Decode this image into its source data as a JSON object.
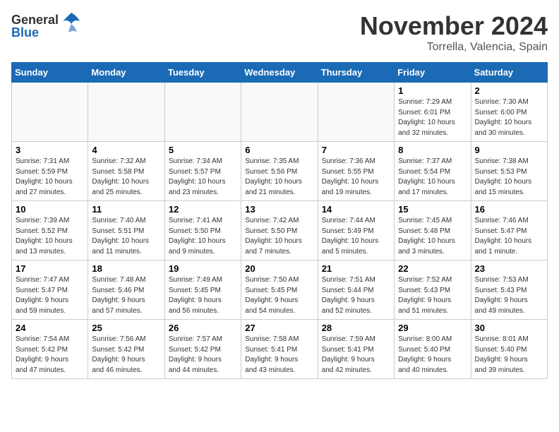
{
  "header": {
    "logo_general": "General",
    "logo_blue": "Blue",
    "month": "November 2024",
    "location": "Torrella, Valencia, Spain"
  },
  "weekdays": [
    "Sunday",
    "Monday",
    "Tuesday",
    "Wednesday",
    "Thursday",
    "Friday",
    "Saturday"
  ],
  "weeks": [
    [
      {
        "day": "",
        "info": ""
      },
      {
        "day": "",
        "info": ""
      },
      {
        "day": "",
        "info": ""
      },
      {
        "day": "",
        "info": ""
      },
      {
        "day": "",
        "info": ""
      },
      {
        "day": "1",
        "info": "Sunrise: 7:29 AM\nSunset: 6:01 PM\nDaylight: 10 hours\nand 32 minutes."
      },
      {
        "day": "2",
        "info": "Sunrise: 7:30 AM\nSunset: 6:00 PM\nDaylight: 10 hours\nand 30 minutes."
      }
    ],
    [
      {
        "day": "3",
        "info": "Sunrise: 7:31 AM\nSunset: 5:59 PM\nDaylight: 10 hours\nand 27 minutes."
      },
      {
        "day": "4",
        "info": "Sunrise: 7:32 AM\nSunset: 5:58 PM\nDaylight: 10 hours\nand 25 minutes."
      },
      {
        "day": "5",
        "info": "Sunrise: 7:34 AM\nSunset: 5:57 PM\nDaylight: 10 hours\nand 23 minutes."
      },
      {
        "day": "6",
        "info": "Sunrise: 7:35 AM\nSunset: 5:56 PM\nDaylight: 10 hours\nand 21 minutes."
      },
      {
        "day": "7",
        "info": "Sunrise: 7:36 AM\nSunset: 5:55 PM\nDaylight: 10 hours\nand 19 minutes."
      },
      {
        "day": "8",
        "info": "Sunrise: 7:37 AM\nSunset: 5:54 PM\nDaylight: 10 hours\nand 17 minutes."
      },
      {
        "day": "9",
        "info": "Sunrise: 7:38 AM\nSunset: 5:53 PM\nDaylight: 10 hours\nand 15 minutes."
      }
    ],
    [
      {
        "day": "10",
        "info": "Sunrise: 7:39 AM\nSunset: 5:52 PM\nDaylight: 10 hours\nand 13 minutes."
      },
      {
        "day": "11",
        "info": "Sunrise: 7:40 AM\nSunset: 5:51 PM\nDaylight: 10 hours\nand 11 minutes."
      },
      {
        "day": "12",
        "info": "Sunrise: 7:41 AM\nSunset: 5:50 PM\nDaylight: 10 hours\nand 9 minutes."
      },
      {
        "day": "13",
        "info": "Sunrise: 7:42 AM\nSunset: 5:50 PM\nDaylight: 10 hours\nand 7 minutes."
      },
      {
        "day": "14",
        "info": "Sunrise: 7:44 AM\nSunset: 5:49 PM\nDaylight: 10 hours\nand 5 minutes."
      },
      {
        "day": "15",
        "info": "Sunrise: 7:45 AM\nSunset: 5:48 PM\nDaylight: 10 hours\nand 3 minutes."
      },
      {
        "day": "16",
        "info": "Sunrise: 7:46 AM\nSunset: 5:47 PM\nDaylight: 10 hours\nand 1 minute."
      }
    ],
    [
      {
        "day": "17",
        "info": "Sunrise: 7:47 AM\nSunset: 5:47 PM\nDaylight: 9 hours\nand 59 minutes."
      },
      {
        "day": "18",
        "info": "Sunrise: 7:48 AM\nSunset: 5:46 PM\nDaylight: 9 hours\nand 57 minutes."
      },
      {
        "day": "19",
        "info": "Sunrise: 7:49 AM\nSunset: 5:45 PM\nDaylight: 9 hours\nand 56 minutes."
      },
      {
        "day": "20",
        "info": "Sunrise: 7:50 AM\nSunset: 5:45 PM\nDaylight: 9 hours\nand 54 minutes."
      },
      {
        "day": "21",
        "info": "Sunrise: 7:51 AM\nSunset: 5:44 PM\nDaylight: 9 hours\nand 52 minutes."
      },
      {
        "day": "22",
        "info": "Sunrise: 7:52 AM\nSunset: 5:43 PM\nDaylight: 9 hours\nand 51 minutes."
      },
      {
        "day": "23",
        "info": "Sunrise: 7:53 AM\nSunset: 5:43 PM\nDaylight: 9 hours\nand 49 minutes."
      }
    ],
    [
      {
        "day": "24",
        "info": "Sunrise: 7:54 AM\nSunset: 5:42 PM\nDaylight: 9 hours\nand 47 minutes."
      },
      {
        "day": "25",
        "info": "Sunrise: 7:56 AM\nSunset: 5:42 PM\nDaylight: 9 hours\nand 46 minutes."
      },
      {
        "day": "26",
        "info": "Sunrise: 7:57 AM\nSunset: 5:42 PM\nDaylight: 9 hours\nand 44 minutes."
      },
      {
        "day": "27",
        "info": "Sunrise: 7:58 AM\nSunset: 5:41 PM\nDaylight: 9 hours\nand 43 minutes."
      },
      {
        "day": "28",
        "info": "Sunrise: 7:59 AM\nSunset: 5:41 PM\nDaylight: 9 hours\nand 42 minutes."
      },
      {
        "day": "29",
        "info": "Sunrise: 8:00 AM\nSunset: 5:40 PM\nDaylight: 9 hours\nand 40 minutes."
      },
      {
        "day": "30",
        "info": "Sunrise: 8:01 AM\nSunset: 5:40 PM\nDaylight: 9 hours\nand 39 minutes."
      }
    ]
  ]
}
